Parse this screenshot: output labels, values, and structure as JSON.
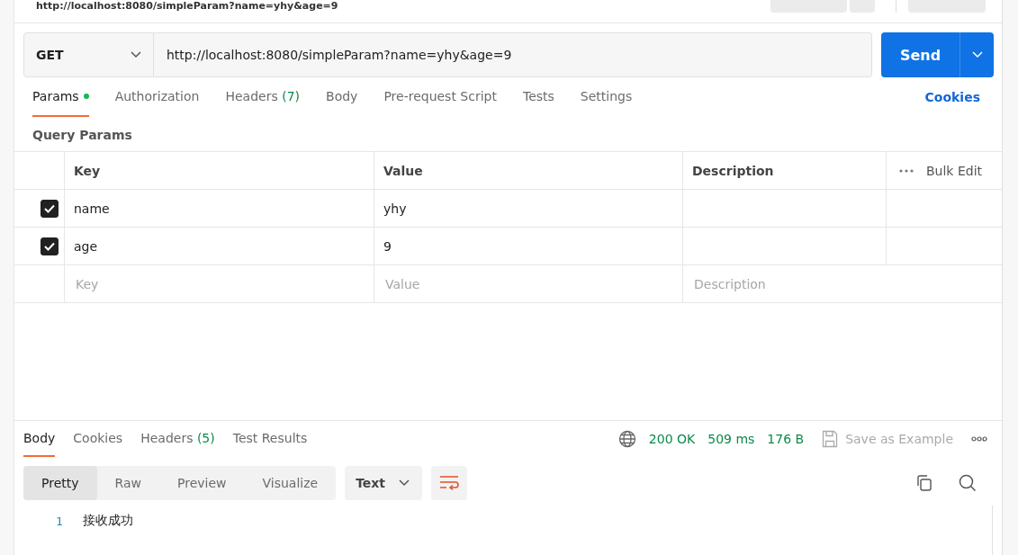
{
  "request_title": "http://localhost:8080/simpleParam?name=yhy&age=9",
  "request": {
    "method": "GET",
    "url": "http://localhost:8080/simpleParam?name=yhy&age=9",
    "send": "Send"
  },
  "request_tabs": [
    {
      "label": "Params",
      "dot": true,
      "selected": true
    },
    {
      "label": "Authorization",
      "dot": false,
      "selected": false
    },
    {
      "label": "Headers",
      "count": "(7)",
      "dot": false,
      "selected": false
    },
    {
      "label": "Body",
      "dot": false,
      "selected": false
    },
    {
      "label": "Pre-request Script",
      "dot": false,
      "selected": false
    },
    {
      "label": "Tests",
      "dot": false,
      "selected": false
    },
    {
      "label": "Settings",
      "dot": false,
      "selected": false
    }
  ],
  "cookies_link": "Cookies",
  "section_title": "Query Params",
  "params_table": {
    "columns": [
      "Key",
      "Value",
      "Description"
    ],
    "bulk_edit": "Bulk Edit",
    "rows": [
      {
        "checked": true,
        "key": "name",
        "value": "yhy"
      },
      {
        "checked": true,
        "key": "age",
        "value": "9"
      }
    ],
    "new_row": {
      "key": {
        "placeholder": "Key"
      },
      "value": {
        "placeholder": "Value"
      },
      "description": {
        "placeholder": "Description"
      }
    }
  },
  "response_tabs": [
    {
      "label": "Body",
      "selected": true
    },
    {
      "label": "Cookies",
      "selected": false
    },
    {
      "label": "Headers",
      "count": "(5)",
      "selected": false
    },
    {
      "label": "Test Results",
      "selected": false
    }
  ],
  "response_meta": {
    "status": "200 OK",
    "time": "509 ms",
    "size": "176 B",
    "save": "Save as Example"
  },
  "view_modes": [
    {
      "label": "Pretty",
      "selected": true
    },
    {
      "label": "Raw",
      "selected": false
    },
    {
      "label": "Preview",
      "selected": false
    },
    {
      "label": "Visualize",
      "selected": false
    }
  ],
  "format": "Text",
  "response_lines": [
    {
      "number": "1",
      "text": "接收成功"
    }
  ]
}
